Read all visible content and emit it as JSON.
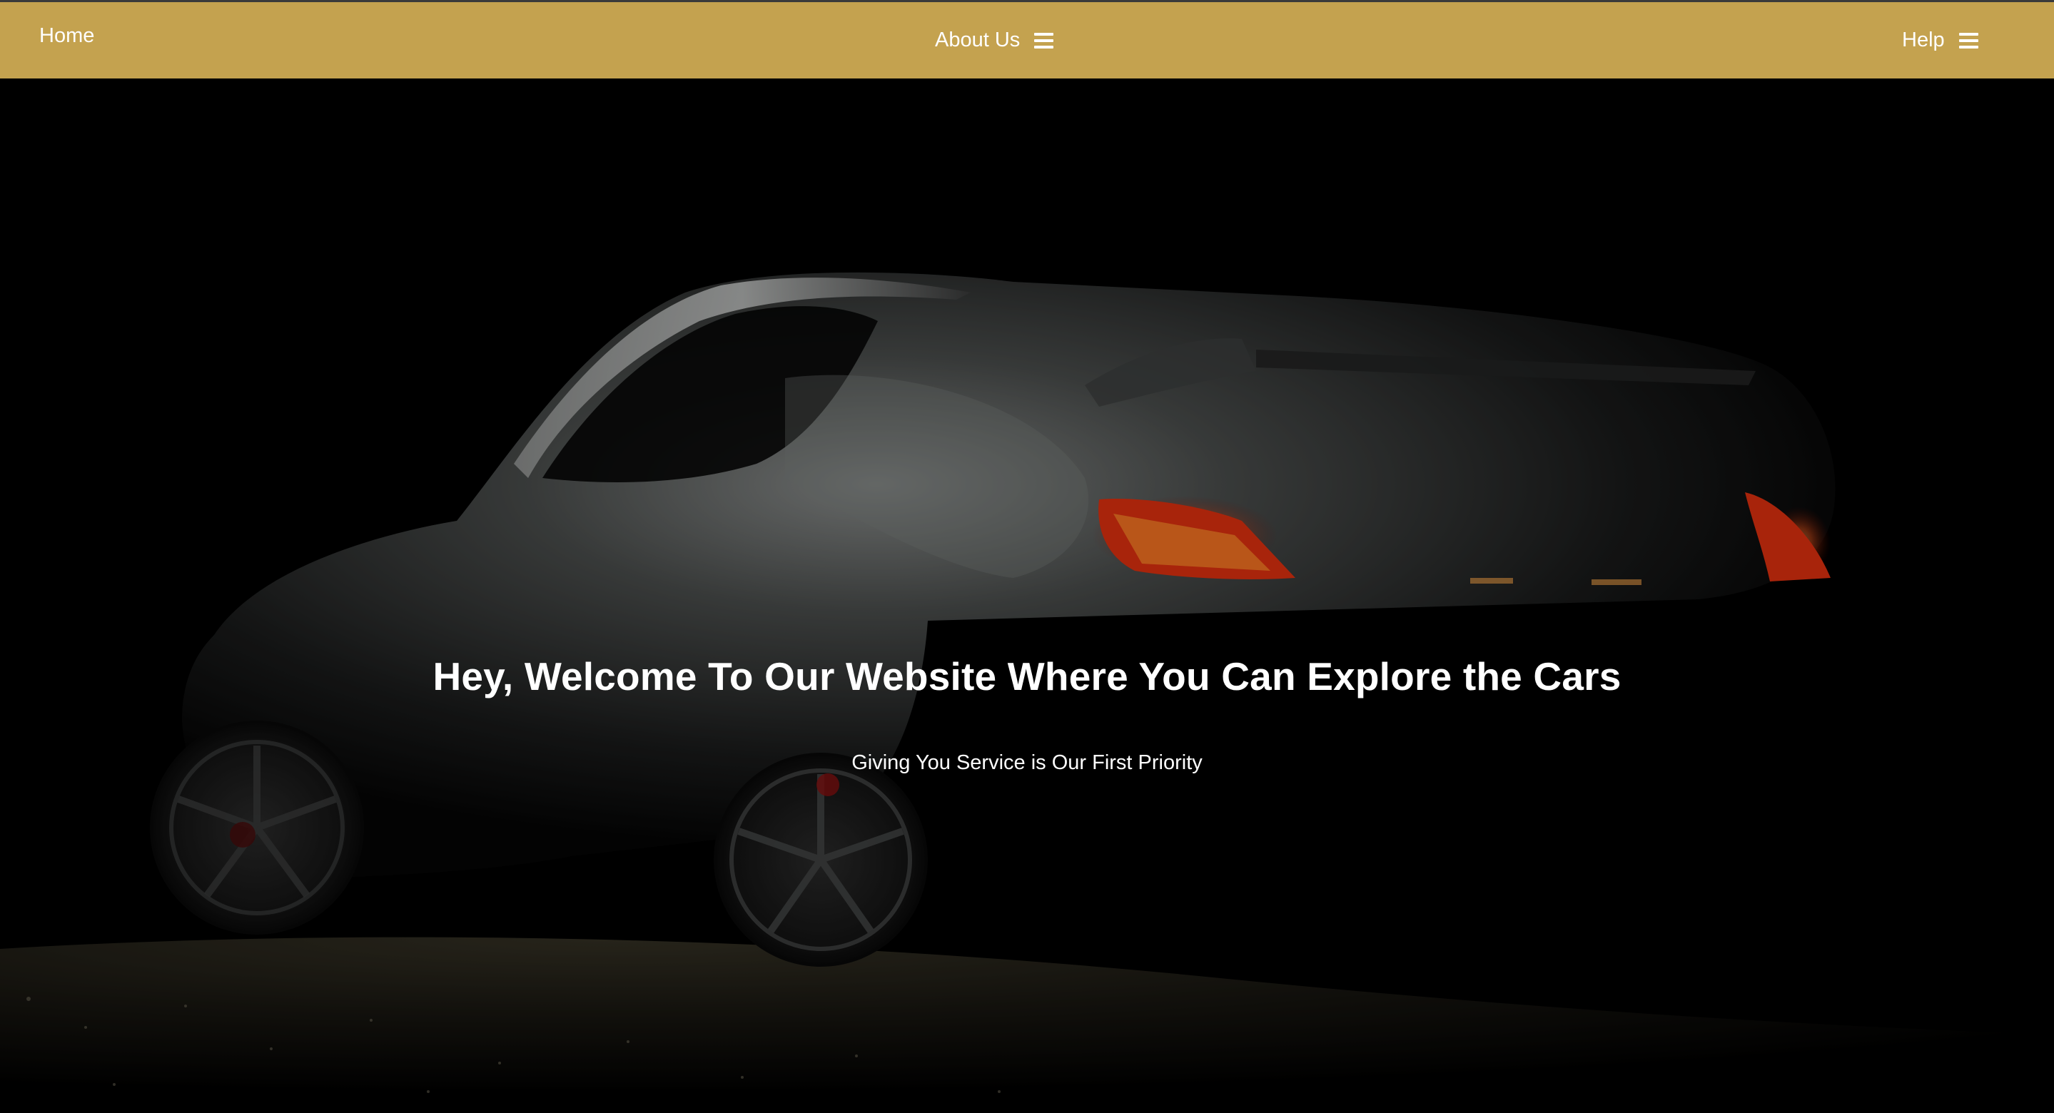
{
  "nav": {
    "home": "Home",
    "about": "About Us",
    "help": "Help",
    "menu_icon": "hamburger-menu-icon"
  },
  "hero": {
    "title": "Hey, Welcome To Our Website Where You Can Explore the Cars",
    "subtitle": "Giving You Service is Our First Priority",
    "image_subject": "dark sports car with red tail lights"
  },
  "colors": {
    "navbar": "#c4a24f",
    "text": "#ffffff",
    "background": "#000000",
    "taillight": "#ff3b1a"
  }
}
